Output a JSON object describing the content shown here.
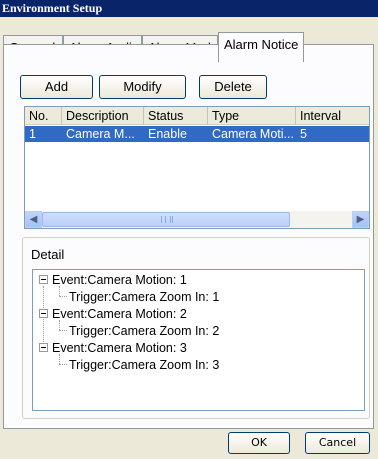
{
  "window": {
    "title": "Environment Setup"
  },
  "tabs": [
    {
      "label": "General"
    },
    {
      "label": "Alarm Audio"
    },
    {
      "label": "Alarm Mode"
    },
    {
      "label": "Alarm Notice",
      "active": true
    }
  ],
  "toolbar": {
    "add_label": "Add",
    "modify_label": "Modify",
    "delete_label": "Delete"
  },
  "list": {
    "columns": [
      "No.",
      "Description",
      "Status",
      "Type",
      "Interval"
    ],
    "rows": [
      {
        "no": "1",
        "description": "Camera M...",
        "status": "Enable",
        "type": "Camera Moti...",
        "interval": "5",
        "selected": true
      }
    ]
  },
  "detail": {
    "label": "Detail",
    "tree": [
      {
        "event": "Event:Camera Motion: 1",
        "trigger": "Trigger:Camera Zoom In: 1"
      },
      {
        "event": "Event:Camera Motion: 2",
        "trigger": "Trigger:Camera Zoom In: 2"
      },
      {
        "event": "Event:Camera Motion: 3",
        "trigger": "Trigger:Camera Zoom In: 3"
      }
    ]
  },
  "footer": {
    "ok_label": "OK",
    "cancel_label": "Cancel"
  },
  "colors": {
    "titlebar": "#0a246a",
    "selection": "#316ac5",
    "face": "#ece9d8"
  }
}
